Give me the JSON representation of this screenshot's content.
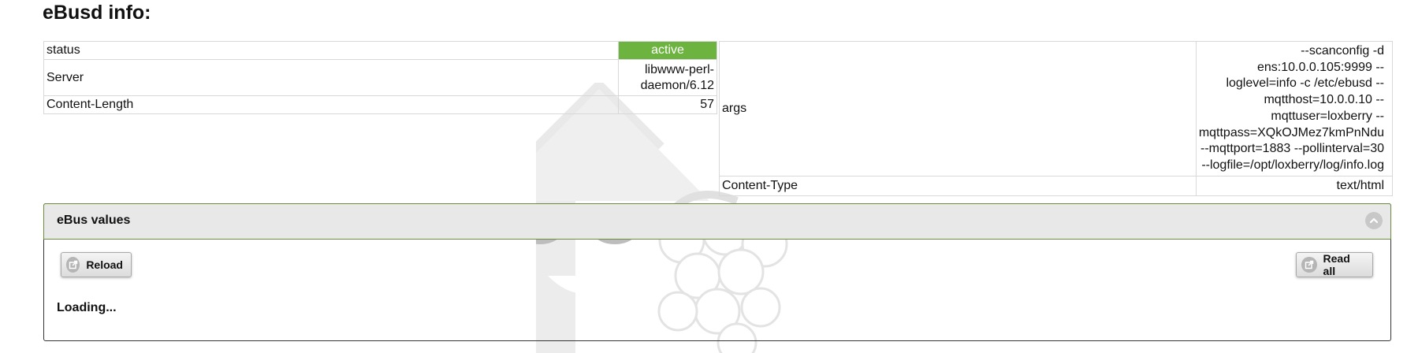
{
  "page": {
    "title": "eBusd info:"
  },
  "info_left": {
    "rows": [
      {
        "key": "status",
        "value": "active",
        "value_color": "#6db33f"
      },
      {
        "key": "Server",
        "value": "libwww-perl-daemon/6.12"
      },
      {
        "key": "Content-Length",
        "value": "57"
      }
    ]
  },
  "info_right": {
    "rows": [
      {
        "key": "args",
        "value": "--scanconfig -d ens:10.0.0.105:9999 --loglevel=info -c /etc/ebusd --mqtthost=10.0.0.10 --mqttuser=loxberry --mqttpass=XQkOJMez7kmPnNdu --mqttport=1883 --pollinterval=30 --logfile=/opt/loxberry/log/info.log"
      },
      {
        "key": "Content-Type",
        "value": "text/html"
      }
    ]
  },
  "panel": {
    "title": "eBus values",
    "reload_label": "Reload",
    "read_all_label": "Read all",
    "loading_text": "Loading..."
  },
  "icons": {
    "collapse": "chevron-up-icon",
    "reload": "external-link-icon",
    "read_all": "external-link-icon",
    "watermark": "loxberry-logo"
  },
  "colors": {
    "status_active": "#6db33f",
    "panel_header_bg": "#e8e8e8",
    "panel_header_border": "#6b8c3c"
  }
}
